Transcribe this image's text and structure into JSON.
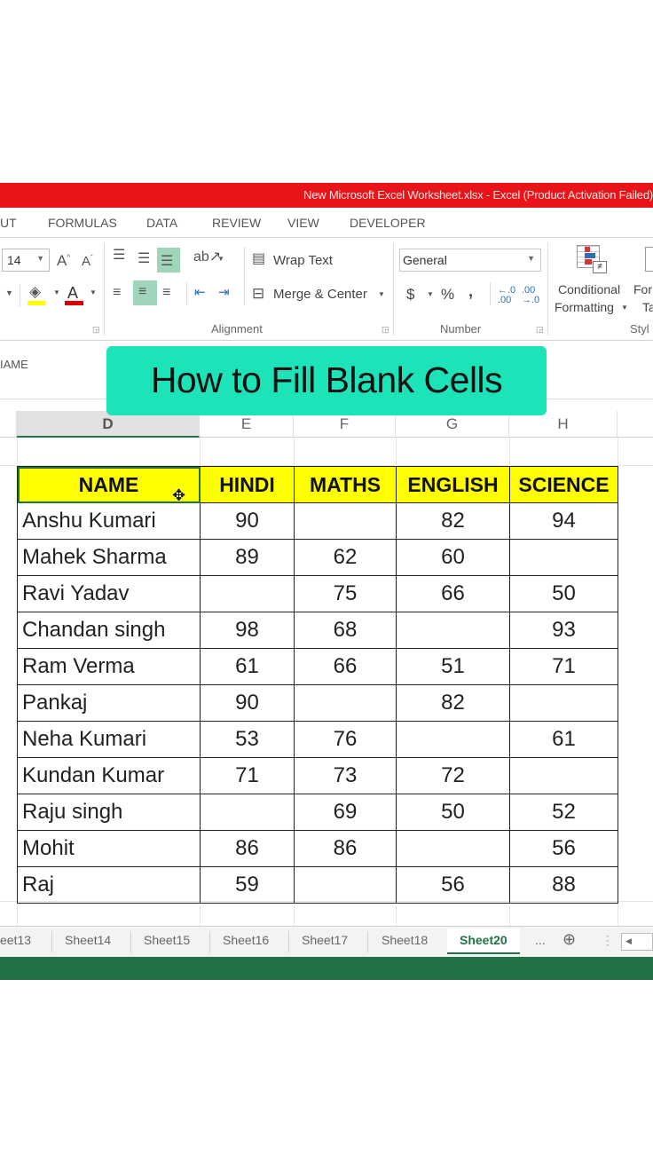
{
  "window": {
    "title": "New Microsoft Excel Worksheet.xlsx -  Excel (Product Activation Failed)"
  },
  "ribbon_tabs": [
    "UT",
    "FORMULAS",
    "DATA",
    "REVIEW",
    "VIEW",
    "DEVELOPER"
  ],
  "ribbon": {
    "font_size": "14",
    "wrap_text": "Wrap Text",
    "merge_center": "Merge & Center",
    "number_format": "General",
    "currency": "$",
    "percent": "%",
    "comma": ",",
    "conditional_formatting_line1": "Conditional",
    "conditional_formatting_line2": "Formatting",
    "format_table_line1": "For",
    "format_table_line2": "Ta",
    "groups": {
      "alignment": "Alignment",
      "number": "Number",
      "styles": "Styl"
    },
    "colors": {
      "fill": "#ffff00",
      "font": "#e00000"
    }
  },
  "name_box": "IAME",
  "banner": {
    "text": "How to Fill Blank Cells",
    "color": "#1de3b8"
  },
  "columns": [
    "D",
    "E",
    "F",
    "G",
    "H"
  ],
  "active_column": "D",
  "table": {
    "headers": [
      "NAME",
      "HINDI",
      "MATHS",
      "ENGLISH",
      "SCIENCE"
    ],
    "rows": [
      [
        "Anshu Kumari",
        "90",
        "",
        "82",
        "94"
      ],
      [
        "Mahek Sharma",
        "89",
        "62",
        "60",
        ""
      ],
      [
        "Ravi Yadav",
        "",
        "75",
        "66",
        "50"
      ],
      [
        "Chandan singh",
        "98",
        "68",
        "",
        "93"
      ],
      [
        "Ram Verma",
        "61",
        "66",
        "51",
        "71"
      ],
      [
        "Pankaj",
        "90",
        "",
        "82",
        ""
      ],
      [
        "Neha Kumari",
        "53",
        "76",
        "",
        "61"
      ],
      [
        "Kundan Kumar",
        "71",
        "73",
        "72",
        ""
      ],
      [
        "Raju singh",
        "",
        "69",
        "50",
        "52"
      ],
      [
        "Mohit",
        "86",
        "86",
        "",
        "56"
      ],
      [
        "Raj",
        "59",
        "",
        "56",
        "88"
      ]
    ],
    "header_color": "#ffff00"
  },
  "sheets": {
    "tabs": [
      "eet13",
      "Sheet14",
      "Sheet15",
      "Sheet16",
      "Sheet17",
      "Sheet18",
      "Sheet20"
    ],
    "active": "Sheet20",
    "more": "...",
    "add_icon": "⊕"
  },
  "theme": {
    "title_bar": "#e8141a",
    "excel_green": "#217346"
  }
}
